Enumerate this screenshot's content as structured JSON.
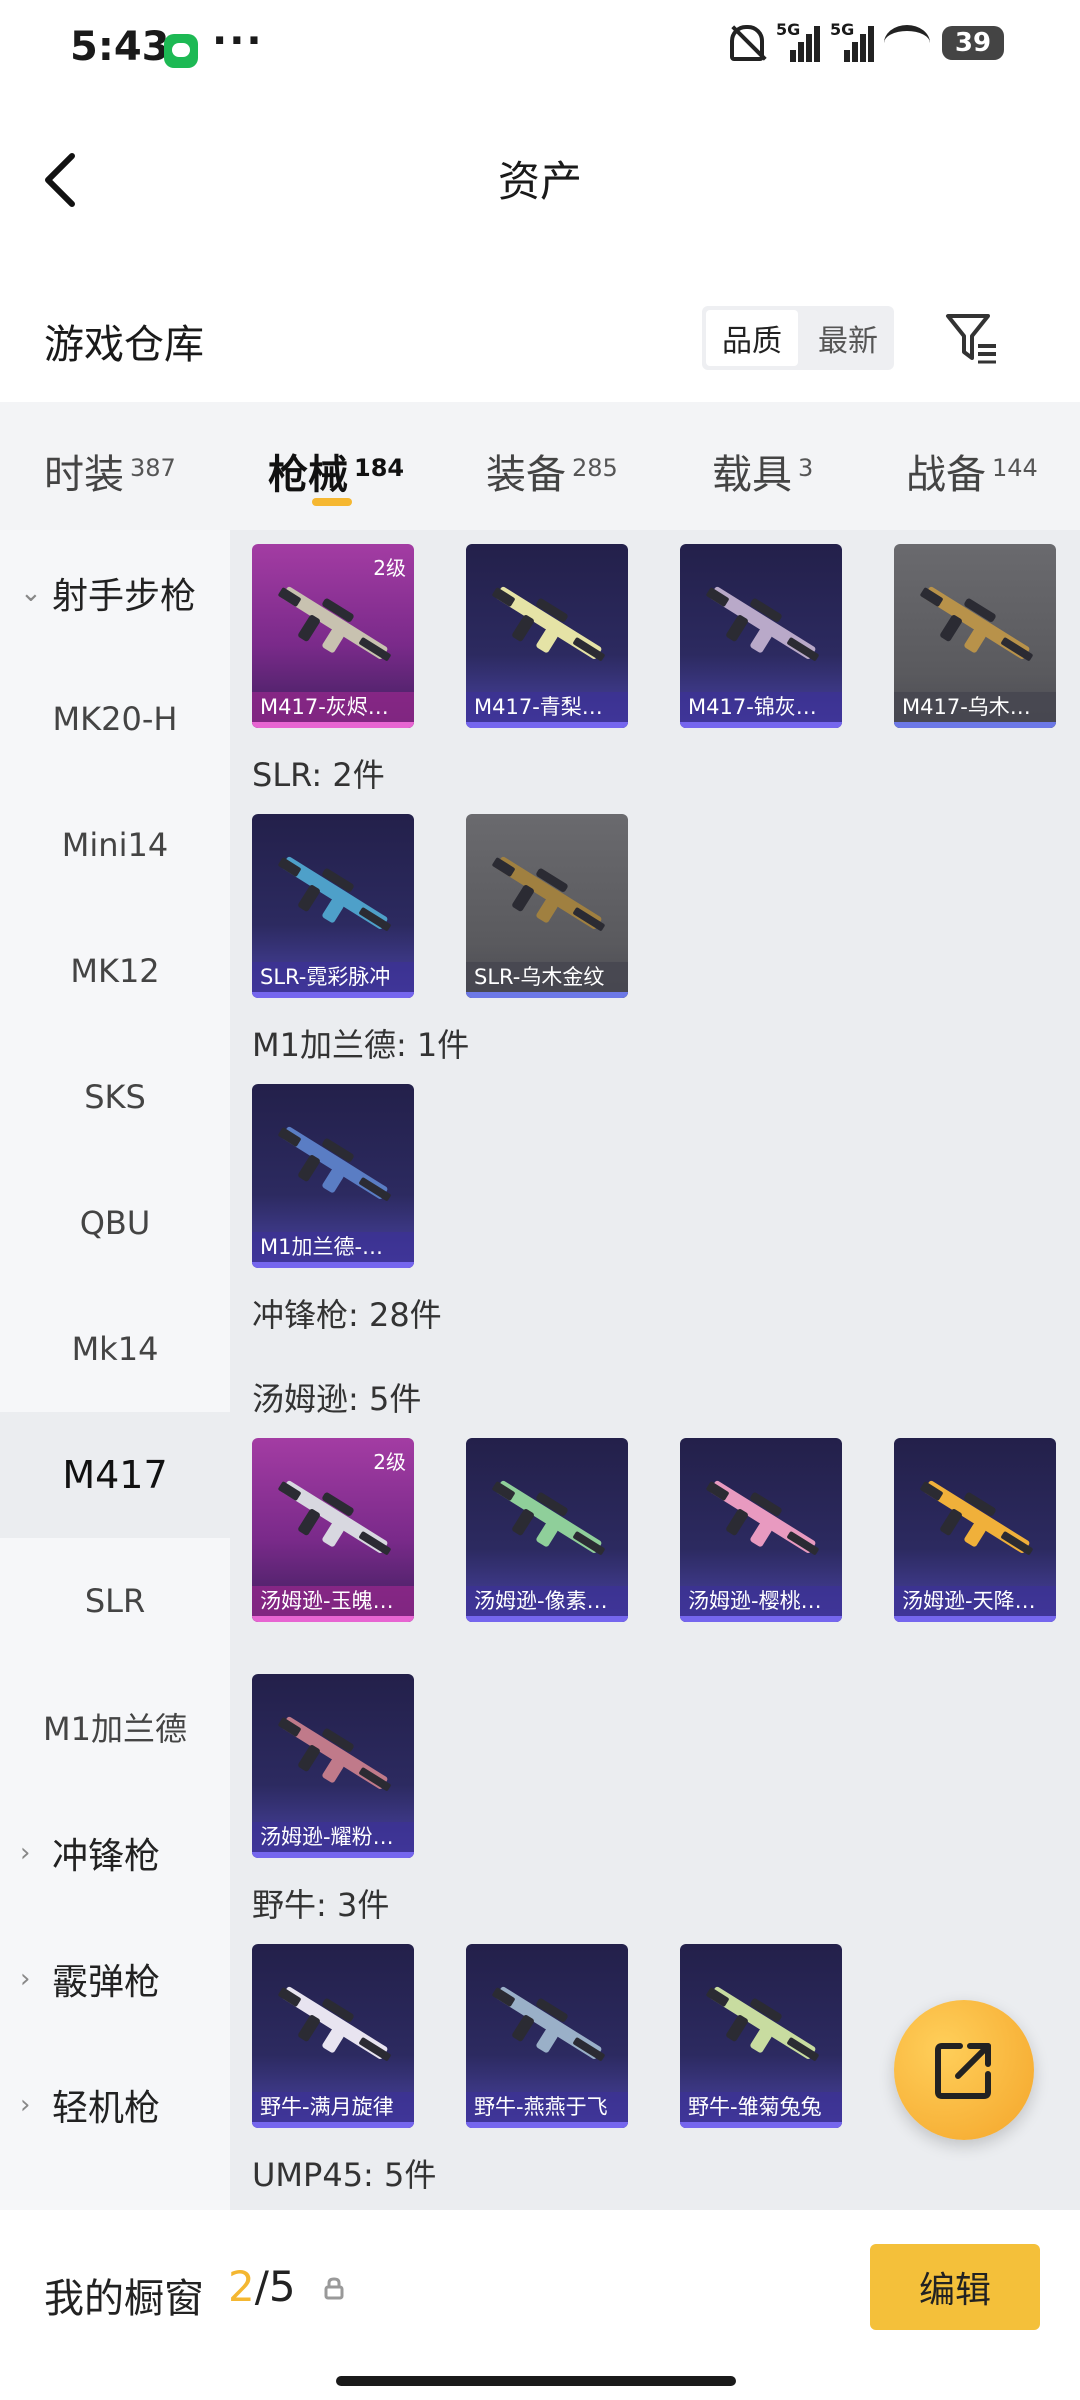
{
  "status_bar": {
    "time": "5:43",
    "dots": "···",
    "sig1": "5G",
    "sig2": "5G",
    "battery": "39"
  },
  "header": {
    "title": "资产"
  },
  "warehouse": {
    "title": "游戏仓库",
    "sort_quality": "品质",
    "sort_newest": "最新"
  },
  "categories": [
    {
      "label": "时装",
      "count": "387"
    },
    {
      "label": "枪械",
      "count": "184"
    },
    {
      "label": "装备",
      "count": "285"
    },
    {
      "label": "载具",
      "count": "3"
    },
    {
      "label": "战备",
      "count": "144"
    }
  ],
  "sidebar": {
    "items": [
      {
        "label": "射手步枪",
        "expanded": true
      },
      {
        "label": "MK20-H"
      },
      {
        "label": "Mini14"
      },
      {
        "label": "MK12"
      },
      {
        "label": "SKS"
      },
      {
        "label": "QBU"
      },
      {
        "label": "Mk14"
      },
      {
        "label": "M417",
        "active": true
      },
      {
        "label": "SLR"
      },
      {
        "label": "M1加兰德"
      },
      {
        "label": "冲锋枪"
      },
      {
        "label": "霰弹枪"
      },
      {
        "label": "轻机枪"
      }
    ]
  },
  "content": {
    "m417": [
      {
        "label": "M417-灰烬…",
        "level": "2级",
        "tier": "pink",
        "gun_color": "#c8c2b0"
      },
      {
        "label": "M417-青梨…",
        "tier": "purple",
        "gun_color": "#e5e3a6"
      },
      {
        "label": "M417-锦灰…",
        "tier": "purple",
        "gun_color": "#b9a9c9"
      },
      {
        "label": "M417-乌木…",
        "tier": "gray",
        "gun_color": "#b8924a"
      }
    ],
    "slr_label": "SLR: 2件",
    "slr": [
      {
        "label": "SLR-霓彩脉冲",
        "tier": "purple",
        "gun_color": "#4ea0c9"
      },
      {
        "label": "SLR-乌木金纹",
        "tier": "gray",
        "gun_color": "#a08040"
      }
    ],
    "m1_label": "M1加兰德: 1件",
    "m1": [
      {
        "label": "M1加兰德-…",
        "tier": "purple",
        "gun_color": "#5a7dc4"
      }
    ],
    "smg_label": "冲锋枪: 28件",
    "thompson_label": "汤姆逊: 5件",
    "thompson": [
      {
        "label": "汤姆逊-玉魄…",
        "level": "2级",
        "tier": "pink",
        "gun_color": "#d8d8e0"
      },
      {
        "label": "汤姆逊-像素…",
        "tier": "purple",
        "gun_color": "#8fcf9a"
      },
      {
        "label": "汤姆逊-樱桃…",
        "tier": "purple",
        "gun_color": "#e89ac0"
      },
      {
        "label": "汤姆逊-天降…",
        "tier": "purple",
        "gun_color": "#f0b03a"
      },
      {
        "label": "汤姆逊-耀粉…",
        "tier": "purple",
        "gun_color": "#c07a8a"
      }
    ],
    "bizon_label": "野牛: 3件",
    "bizon": [
      {
        "label": "野牛-满月旋律",
        "tier": "purple",
        "gun_color": "#e8e4f0"
      },
      {
        "label": "野牛-燕燕于飞",
        "tier": "purple",
        "gun_color": "#9ab0c8"
      },
      {
        "label": "野牛-雏菊兔兔",
        "tier": "purple",
        "gun_color": "#c8dca0"
      }
    ],
    "ump_label": "UMP45: 5件"
  },
  "bottom_bar": {
    "label": "我的橱窗",
    "current": "2",
    "total": "/5",
    "edit_label": "编辑"
  },
  "icons": {
    "back": "back-arrow-icon",
    "filter": "filter-icon",
    "share": "share-icon",
    "lock": "lock-icon"
  },
  "colors": {
    "accent": "#f4b731",
    "edit_button": "#f4c03a"
  }
}
